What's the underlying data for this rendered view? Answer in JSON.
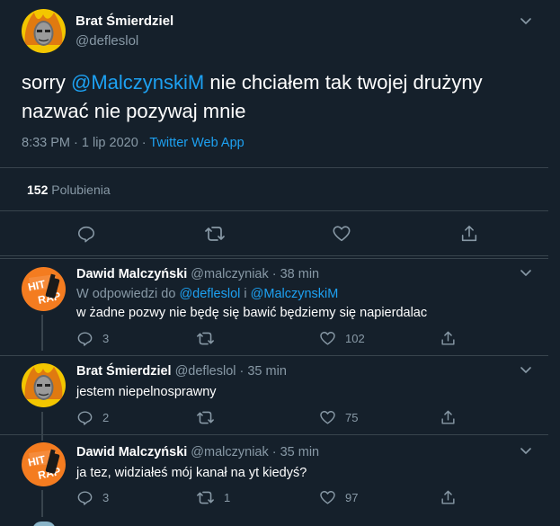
{
  "main_tweet": {
    "author": "Brat Śmierdziel",
    "handle": "@defleslol",
    "text_before": "sorry ",
    "mention": "@MalczynskiM",
    "text_after": " nie chciałem tak twojej drużyny nazwać nie pozywaj mnie",
    "time": "8:33 PM · 1 lip 2020 · ",
    "source": "Twitter Web App",
    "likes_count": "152",
    "likes_label": "Polubienia",
    "actions": [
      "reply-icon",
      "retweet-icon",
      "like-icon",
      "share-icon"
    ]
  },
  "replies": [
    {
      "author": "Dawid Malczyński",
      "handle": "@malczyniak",
      "time": "· 38 min",
      "reply_to_prefix": "W odpowiedzi do ",
      "reply_to_1": "@defleslol",
      "reply_to_join": " i ",
      "reply_to_2": "@MalczynskiM",
      "text": "w żadne pozwy nie będę się bawić będziemy się napierdalac",
      "reply_count": "3",
      "retweet_count": "",
      "like_count": "102"
    },
    {
      "author": "Brat Śmierdziel",
      "handle": "@defleslol",
      "time": "· 35 min",
      "text": "jestem niepelnosprawny",
      "reply_count": "2",
      "retweet_count": "",
      "like_count": "75"
    },
    {
      "author": "Dawid Malczyński",
      "handle": "@malczyniak",
      "time": "· 35 min",
      "text": "ja tez, widziałeś mój kanał na yt kiedyś?",
      "reply_count": "3",
      "retweet_count": "1",
      "like_count": "97"
    }
  ],
  "avatar_text": {
    "hit": "HIT",
    "rap": "RAP"
  },
  "colors": {
    "background": "#15202b",
    "accent": "#1da1f2",
    "muted": "#8899a6",
    "divider": "#38444d",
    "avatar_orange": "#f47c20",
    "avatar_yellow": "#f3c600"
  }
}
